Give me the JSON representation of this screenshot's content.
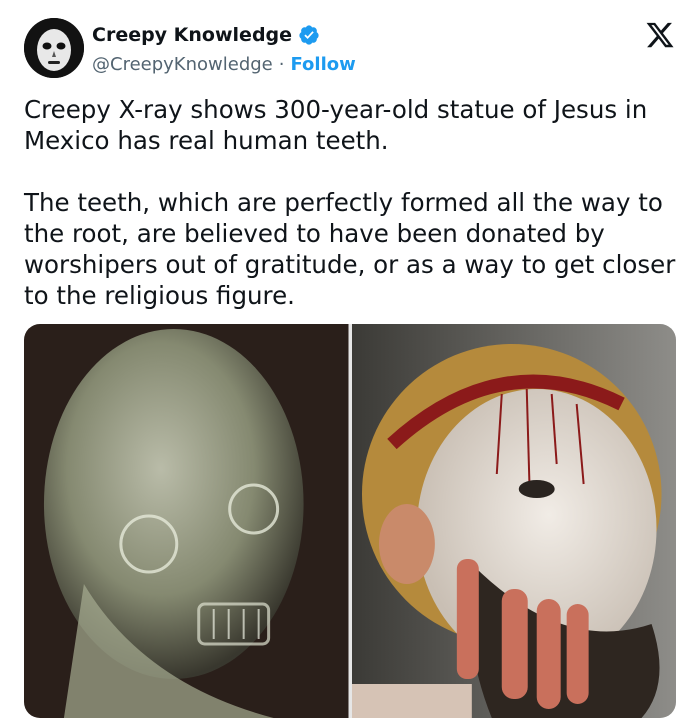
{
  "tweet": {
    "author": {
      "display_name": "Creepy Knowledge",
      "handle": "@CreepyKnowledge",
      "separator": "·",
      "follow_label": "Follow",
      "verified": true,
      "verified_color": "#1d9bf0",
      "avatar_icon": "skull-mask-avatar"
    },
    "platform_icon": "x-logo-icon",
    "text": {
      "paragraph_1": "Creepy X-ray shows 300-year-old statue of Jesus in Mexico has real human teeth.",
      "paragraph_2": "The teeth, which are perfectly formed all the way to the root, are believed to have been donated by worshipers out of gratitude, or as a way to get closer to the religious figure."
    },
    "media": [
      {
        "kind": "image",
        "subject": "x-ray-of-statue-head"
      },
      {
        "kind": "image",
        "subject": "painted-statue-of-jesus"
      }
    ]
  },
  "colors": {
    "text": "#0f1419",
    "secondary": "#536471",
    "accent": "#1d9bf0"
  }
}
